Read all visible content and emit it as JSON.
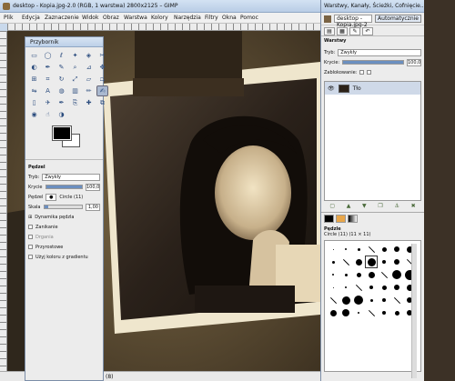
{
  "window": {
    "title": "desktop - Kopia.jpg-2.0 (RGB, 1 warstwa) 2800x2125 – GIMP",
    "menu": [
      "Plik",
      "Edycja",
      "Zaznaczenie",
      "Widok",
      "Obraz",
      "Warstwa",
      "Kolory",
      "Narzędzia",
      "Filtry",
      "Okna",
      "Pomoc"
    ]
  },
  "status": {
    "text": "(8)"
  },
  "toolbox": {
    "title": "Przybornik",
    "tools": [
      "rect-select",
      "ellipse-select",
      "free-select",
      "fuzzy-select",
      "color-select",
      "scissors",
      "foreground-select",
      "paths",
      "color-picker",
      "zoom",
      "measure",
      "move",
      "align",
      "crop",
      "rotate",
      "scale",
      "shear",
      "perspective",
      "flip",
      "text",
      "bucket-fill",
      "blend",
      "pencil",
      "paintbrush",
      "eraser",
      "airbrush",
      "ink",
      "clone",
      "heal",
      "perspective-clone",
      "convolve",
      "smudge",
      "dodge-burn"
    ],
    "selected_tool": 23,
    "options_title": "Pędzel",
    "mode_label": "Tryb:",
    "mode_value": "Zwykły",
    "opacity_label": "Krycie",
    "opacity_value": "100,0",
    "opacity_fraction": 1.0,
    "brush_label": "Pędzel",
    "brush_value": "Circle (11)",
    "scale_label": "Skala",
    "scale_value": "1,00",
    "scale_fraction": 0.1,
    "pressure_label": "Dynamika pędzla",
    "fade_label": "Zanikanie",
    "jitter_label": "Drgania",
    "incremental_label": "Przyrostowe",
    "gradient_label": "Użyj koloru z gradientu"
  },
  "dock": {
    "title": "Warstwy, Kanały, Ścieżki, Cofnięcie...",
    "image_name": "desktop - Kopia.jpg-2",
    "auto_label": "Automatycznie",
    "layers_title": "Warstwy",
    "mode_label": "Tryb:",
    "mode_value": "Zwykły",
    "opacity_label": "Krycie:",
    "opacity_value": "100,0",
    "lock_label": "Zablokowanie:",
    "layer_name": "Tło",
    "brushes_title": "Pędzle",
    "brush_info": "Circle (11) (11 × 11)"
  },
  "colors": {
    "fg": "#000000",
    "bg": "#ffffff",
    "accent": "#6b8fc0"
  }
}
